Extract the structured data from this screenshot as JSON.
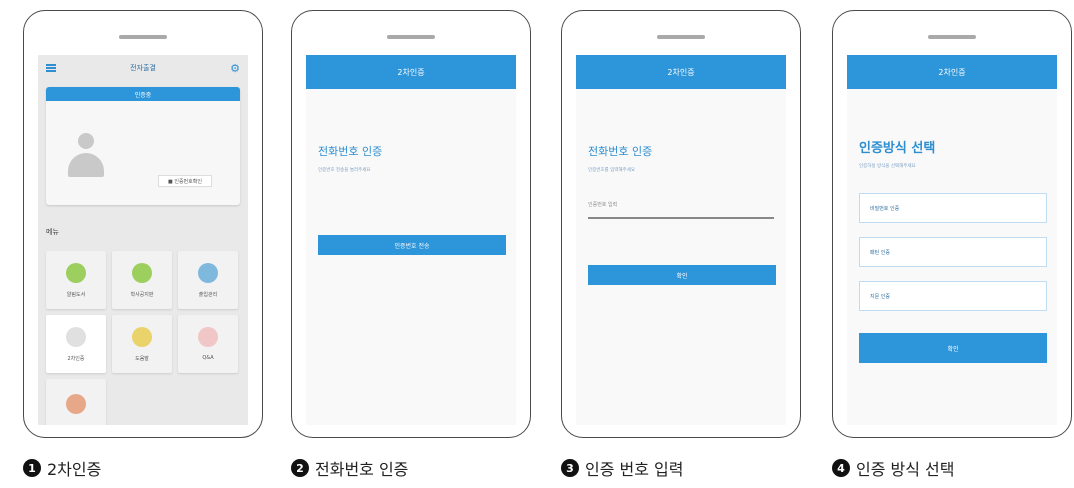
{
  "phones": {
    "p1": {
      "topbar_title": "전자출결",
      "card_header": "인증중",
      "card_button": "■ 인증번호확인",
      "menu_label": "메뉴",
      "tiles": [
        {
          "label": "알림도서",
          "icon": "compass-icon",
          "color": "#9ccf5e"
        },
        {
          "label": "학사공지판",
          "icon": "chat-icon",
          "color": "#9ccf5e"
        },
        {
          "label": "출입관리",
          "icon": "car-icon",
          "color": "#7fb8dd"
        },
        {
          "label": "2차인증",
          "icon": "timer-icon",
          "color": "#e0e0e0"
        },
        {
          "label": "도움말",
          "icon": "bulb-icon",
          "color": "#e9d36a"
        },
        {
          "label": "Q&A",
          "icon": "qna-icon",
          "color": "#f0c6c6"
        },
        {
          "label": "",
          "icon": "misc-icon",
          "color": "#e7a88a"
        }
      ]
    },
    "p2": {
      "header": "2차인증",
      "title": "전화번호 인증",
      "subtitle": "인증번호 전송을 눌러주세요",
      "button": "인증번호 전송"
    },
    "p3": {
      "header": "2차인증",
      "title": "전화번호 인증",
      "subtitle": "인증번호를 입력해주세요",
      "input_placeholder": "인증번호 입력",
      "button": "확인"
    },
    "p4": {
      "header": "2차인증",
      "title": "인증방식 선택",
      "subtitle": "인증하실 방식을 선택해주세요",
      "options": [
        "비밀번호 인증",
        "패턴 인증",
        "지문 인증"
      ],
      "button": "확인"
    }
  },
  "captions": [
    {
      "num": "1",
      "text": "2차인증"
    },
    {
      "num": "2",
      "text": "전화번호 인증"
    },
    {
      "num": "3",
      "text": "인증 번호 입력"
    },
    {
      "num": "4",
      "text": "인증 방식 선택"
    }
  ],
  "colors": {
    "accent": "#2d95d9"
  }
}
